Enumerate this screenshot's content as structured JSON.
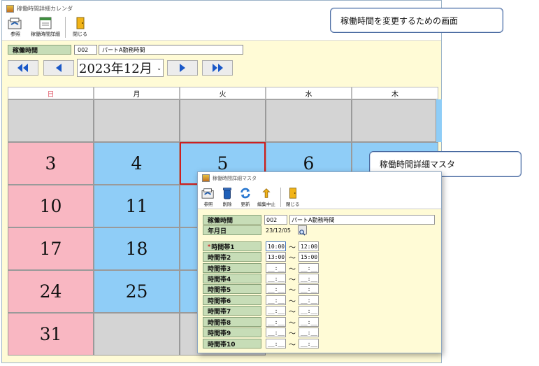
{
  "main_window": {
    "title": "稼働時間詳細カレンダ",
    "toolbar": [
      {
        "label": "参照",
        "icon": "browse-icon"
      },
      {
        "label": "稼働時間詳細",
        "icon": "detail-icon"
      },
      {
        "label": "閉じる",
        "icon": "exit-door-icon"
      }
    ],
    "header": {
      "label": "稼働時間",
      "code": "002",
      "name": "パートA勤務時間"
    },
    "month_select": {
      "value": "2023年12月"
    },
    "weekdays": [
      "日",
      "月",
      "火",
      "水",
      "木"
    ],
    "rows": [
      [
        "",
        "",
        "",
        "",
        ""
      ],
      [
        "3",
        "4",
        "5",
        "6",
        ""
      ],
      [
        "10",
        "11",
        "",
        "",
        ""
      ],
      [
        "17",
        "18",
        "",
        "",
        ""
      ],
      [
        "24",
        "25",
        "",
        "",
        ""
      ],
      [
        "31",
        "",
        "",
        "",
        ""
      ]
    ]
  },
  "callout_main": "稼働時間を変更するための画面",
  "callout_dialog": "稼働時間詳細マスタ",
  "colors": {
    "sunday": "#f9b7c2",
    "weekday": "#8fcdf7",
    "empty": "#d4d4d4",
    "selected_border": "#cc2020"
  },
  "dialog": {
    "title": "稼働時間詳細マスタ",
    "toolbar": [
      {
        "label": "参照",
        "icon": "browse-icon"
      },
      {
        "label": "削除",
        "icon": "trash-icon"
      },
      {
        "label": "更新",
        "icon": "refresh-icon"
      },
      {
        "label": "編集中止",
        "icon": "undo-icon"
      },
      {
        "label": "閉じる",
        "icon": "exit-door-icon"
      }
    ],
    "fields": {
      "operating_label": "稼働時間",
      "operating_code": "002",
      "operating_name": "パートA勤務時間",
      "date_label": "年月日",
      "date_value": "23/12/05"
    },
    "required_mark": "*",
    "tilde": "～",
    "time_slots": [
      {
        "label": "時間帯1",
        "start": "10:00",
        "end": "12:00"
      },
      {
        "label": "時間帯2",
        "start": "13:00",
        "end": "15:00"
      },
      {
        "label": "時間帯3",
        "start": "__:__",
        "end": "__:__"
      },
      {
        "label": "時間帯4",
        "start": "__:__",
        "end": "__:__"
      },
      {
        "label": "時間帯5",
        "start": "__:__",
        "end": "__:__"
      },
      {
        "label": "時間帯6",
        "start": "__:__",
        "end": "__:__"
      },
      {
        "label": "時間帯7",
        "start": "__:__",
        "end": "__:__"
      },
      {
        "label": "時間帯8",
        "start": "__:__",
        "end": "__:__"
      },
      {
        "label": "時間帯9",
        "start": "__:__",
        "end": "__:__"
      },
      {
        "label": "時間帯10",
        "start": "__:__",
        "end": "__:__"
      }
    ]
  }
}
